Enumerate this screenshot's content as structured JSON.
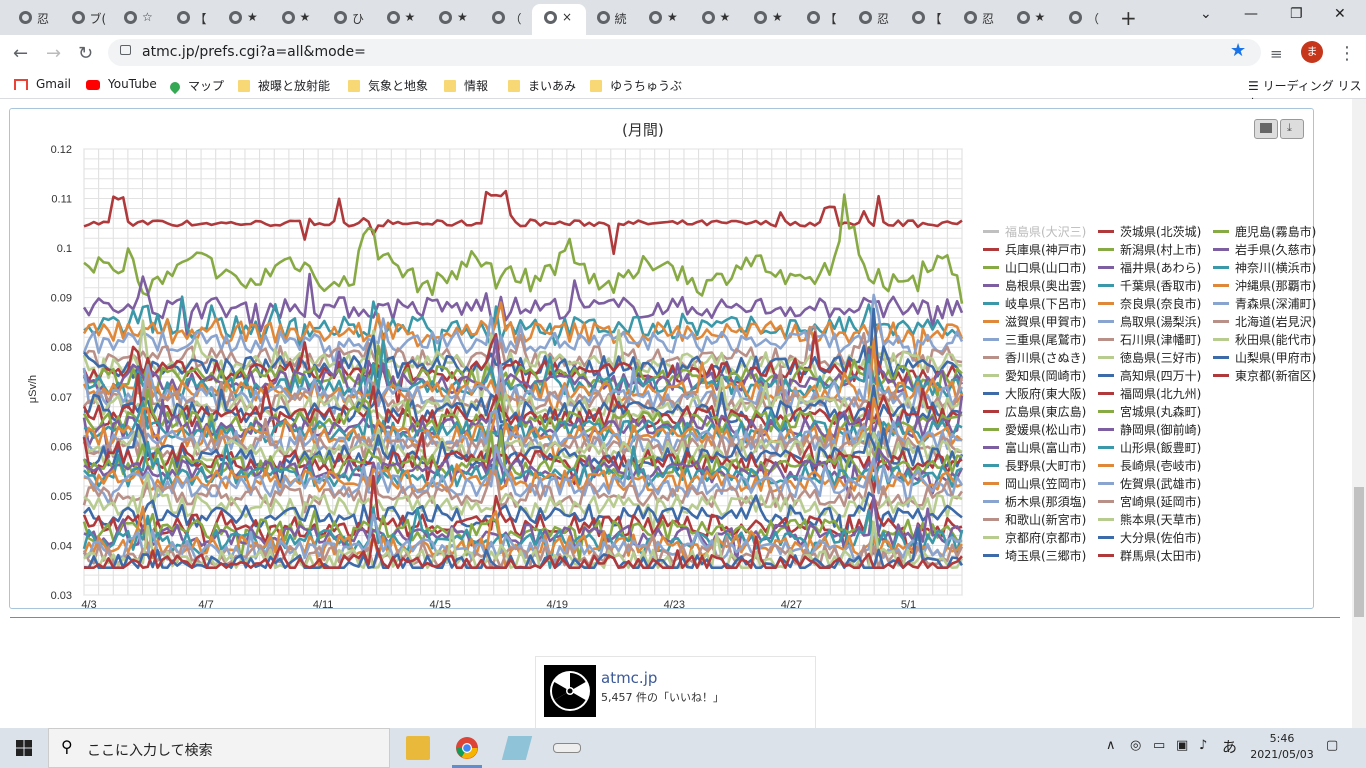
{
  "browser": {
    "tabs": [
      {
        "title": "忍"
      },
      {
        "title": "ブ("
      },
      {
        "title": "☆"
      },
      {
        "title": "【"
      },
      {
        "title": "★"
      },
      {
        "title": "★"
      },
      {
        "title": "ひ"
      },
      {
        "title": "★"
      },
      {
        "title": "★"
      },
      {
        "title": "（"
      },
      {
        "title": "×",
        "active": true
      },
      {
        "title": "続"
      },
      {
        "title": "★"
      },
      {
        "title": "★"
      },
      {
        "title": "★"
      },
      {
        "title": "【"
      },
      {
        "title": "忍"
      },
      {
        "title": "【"
      },
      {
        "title": "忍"
      },
      {
        "title": "★"
      },
      {
        "title": "（"
      }
    ],
    "new_tab": "+",
    "url": "atmc.jp/prefs.cgi?a=all&mode=",
    "avatar_letter": "ま",
    "bookmarks": [
      {
        "label": "Gmail",
        "icon": "gmail-icon"
      },
      {
        "label": "YouTube",
        "icon": "youtube-icon"
      },
      {
        "label": "マップ",
        "icon": "maps-icon"
      },
      {
        "label": "被曝と放射能",
        "icon": "folder-icon"
      },
      {
        "label": "気象と地象",
        "icon": "folder-icon"
      },
      {
        "label": "情報",
        "icon": "folder-icon"
      },
      {
        "label": "まいあみ",
        "icon": "folder-icon"
      },
      {
        "label": "ゆうちゅうぶ",
        "icon": "folder-icon"
      }
    ],
    "reading_list": "リーディング リスト"
  },
  "chart_data": {
    "type": "line",
    "title": "(月間)",
    "ylabel": "μSv/h",
    "xlabel": "",
    "ylim": [
      0.03,
      0.12
    ],
    "yticks": [
      "0.12",
      "0.11",
      "0.1",
      "0.09",
      "0.08",
      "0.07",
      "0.06",
      "0.05",
      "0.04",
      "0.03"
    ],
    "xticks": [
      "4/3",
      "4/7",
      "4/11",
      "4/15",
      "4/19",
      "4/23",
      "4/27",
      "5/1"
    ],
    "grid": true,
    "legend_placement": "right",
    "series": [
      {
        "name": "福島県(大沢三)",
        "color": "#c0c0c0",
        "base": null,
        "hidden": true
      },
      {
        "name": "兵庫県(神戸市)",
        "color": "#b0393c",
        "base": 0.105
      },
      {
        "name": "山口県(山口市)",
        "color": "#88aa44",
        "base": 0.095
      },
      {
        "name": "島根県(奥出雲)",
        "color": "#7d5ea0",
        "base": 0.088
      },
      {
        "name": "岐阜県(下呂市)",
        "color": "#3a98a8",
        "base": 0.084
      },
      {
        "name": "滋賀県(甲賀市)",
        "color": "#e0883a",
        "base": 0.083
      },
      {
        "name": "三重県(尾鷲市)",
        "color": "#8aa4d0",
        "base": 0.081
      },
      {
        "name": "香川県(さぬき)",
        "color": "#b89088",
        "base": 0.078
      },
      {
        "name": "愛知県(岡崎市)",
        "color": "#b8cc90",
        "base": 0.077
      },
      {
        "name": "大阪府(東大阪)",
        "color": "#3d6aa8",
        "base": 0.076
      },
      {
        "name": "広島県(東広島)",
        "color": "#b0393c",
        "base": 0.075
      },
      {
        "name": "愛媛県(松山市)",
        "color": "#88aa44",
        "base": 0.074
      },
      {
        "name": "富山県(富山市)",
        "color": "#7d5ea0",
        "base": 0.073
      },
      {
        "name": "長野県(大町市)",
        "color": "#3a98a8",
        "base": 0.072
      },
      {
        "name": "岡山県(笠岡市)",
        "color": "#e0883a",
        "base": 0.071
      },
      {
        "name": "栃木県(那須塩)",
        "color": "#8aa4d0",
        "base": 0.07
      },
      {
        "name": "和歌山(新宮市)",
        "color": "#b89088",
        "base": 0.069
      },
      {
        "name": "京都府(京都市)",
        "color": "#b8cc90",
        "base": 0.068
      },
      {
        "name": "埼玉県(三郷市)",
        "color": "#3d6aa8",
        "base": 0.067
      },
      {
        "name": "茨城県(北茨城)",
        "color": "#b0393c",
        "base": 0.066
      },
      {
        "name": "新潟県(村上市)",
        "color": "#88aa44",
        "base": 0.065
      },
      {
        "name": "福井県(あわら)",
        "color": "#7d5ea0",
        "base": 0.064
      },
      {
        "name": "千葉県(香取市)",
        "color": "#3a98a8",
        "base": 0.063
      },
      {
        "name": "奈良県(奈良市)",
        "color": "#e0883a",
        "base": 0.062
      },
      {
        "name": "鳥取県(湯梨浜)",
        "color": "#8aa4d0",
        "base": 0.061
      },
      {
        "name": "石川県(津幡町)",
        "color": "#b89088",
        "base": 0.06
      },
      {
        "name": "徳島県(三好市)",
        "color": "#b8cc90",
        "base": 0.059
      },
      {
        "name": "高知県(四万十)",
        "color": "#3d6aa8",
        "base": 0.058
      },
      {
        "name": "福岡県(北九州)",
        "color": "#b0393c",
        "base": 0.057
      },
      {
        "name": "宮城県(丸森町)",
        "color": "#88aa44",
        "base": 0.056
      },
      {
        "name": "静岡県(御前崎)",
        "color": "#7d5ea0",
        "base": 0.055
      },
      {
        "name": "山形県(飯豊町)",
        "color": "#3a98a8",
        "base": 0.054
      },
      {
        "name": "長崎県(壱岐市)",
        "color": "#e0883a",
        "base": 0.053
      },
      {
        "name": "佐賀県(武雄市)",
        "color": "#8aa4d0",
        "base": 0.052
      },
      {
        "name": "宮崎県(延岡市)",
        "color": "#b89088",
        "base": 0.05
      },
      {
        "name": "熊本県(天草市)",
        "color": "#b8cc90",
        "base": 0.048
      },
      {
        "name": "大分県(佐伯市)",
        "color": "#3d6aa8",
        "base": 0.046
      },
      {
        "name": "群馬県(太田市)",
        "color": "#b0393c",
        "base": 0.044
      },
      {
        "name": "鹿児島(霧島市)",
        "color": "#88aa44",
        "base": 0.043
      },
      {
        "name": "岩手県(久慈市)",
        "color": "#7d5ea0",
        "base": 0.042
      },
      {
        "name": "神奈川(横浜市)",
        "color": "#3a98a8",
        "base": 0.041
      },
      {
        "name": "沖縄県(那覇市)",
        "color": "#e0883a",
        "base": 0.04
      },
      {
        "name": "青森県(深浦町)",
        "color": "#8aa4d0",
        "base": 0.039
      },
      {
        "name": "北海道(岩見沢)",
        "color": "#b89088",
        "base": 0.038
      },
      {
        "name": "秋田県(能代市)",
        "color": "#b8cc90",
        "base": 0.037
      },
      {
        "name": "山梨県(甲府市)",
        "color": "#3d6aa8",
        "base": 0.036
      },
      {
        "name": "東京都(新宿区)",
        "color": "#b0393c",
        "base": 0.036
      }
    ]
  },
  "facebook": {
    "title": "atmc.jp",
    "likes": "5,457 件の「いいね！」"
  },
  "taskbar": {
    "search_placeholder": "ここに入力して検索",
    "ime": "あ",
    "time": "5:46",
    "date": "2021/05/03"
  }
}
